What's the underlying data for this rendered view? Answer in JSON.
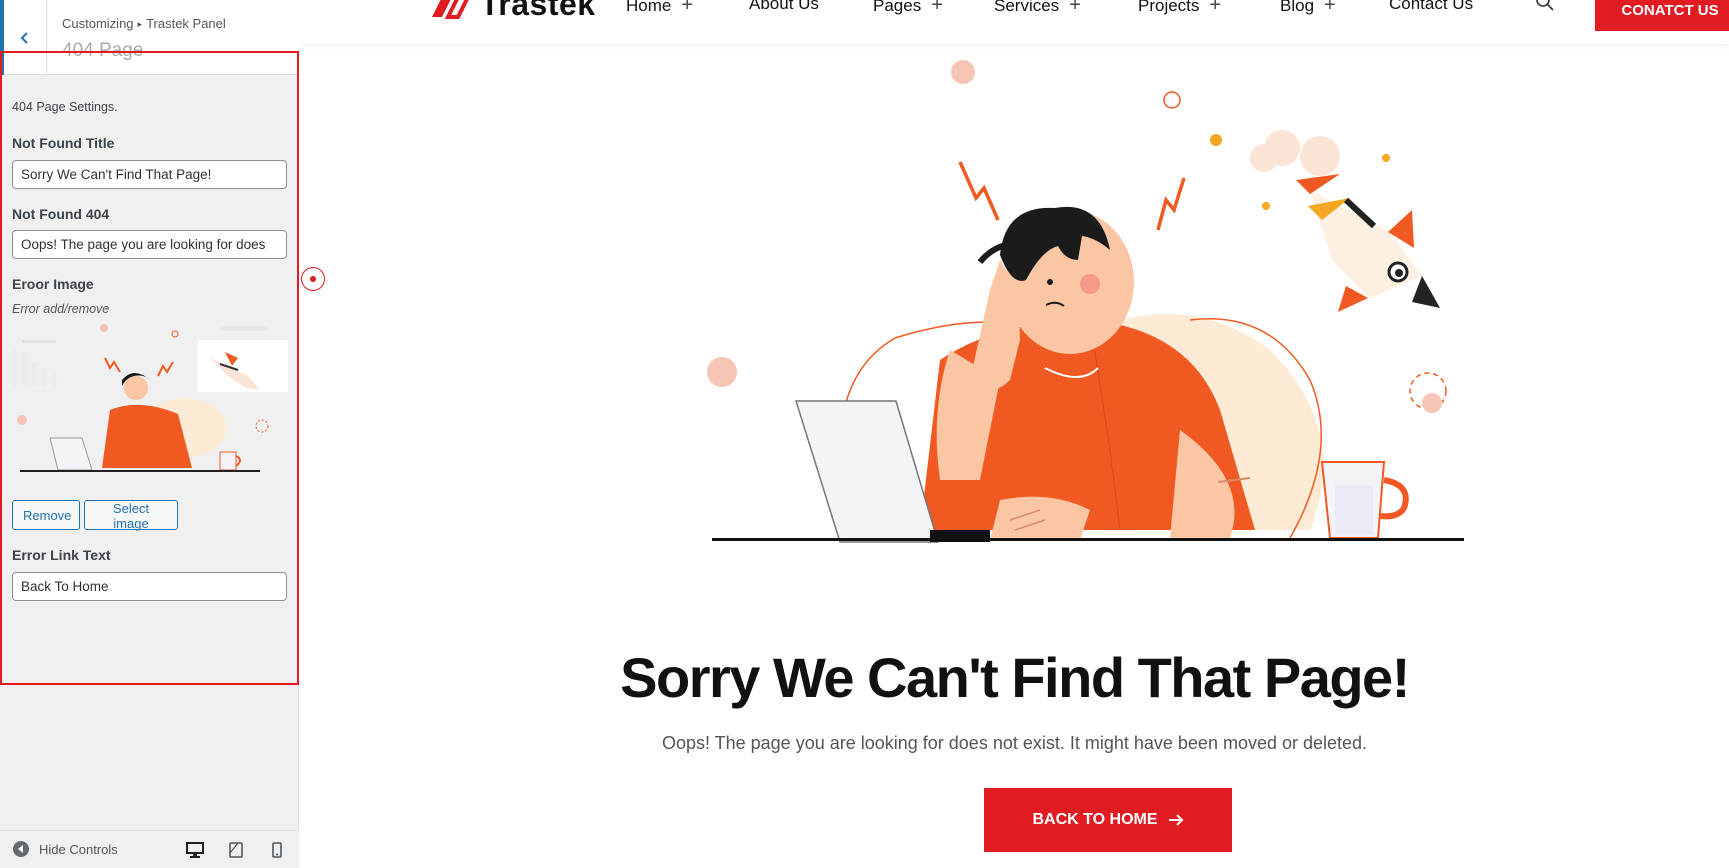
{
  "customizer": {
    "breadcrumb_root": "Customizing",
    "breadcrumb_panel": "Trastek Panel",
    "section_title": "404 Page",
    "description": "404 Page Settings.",
    "controls": {
      "title_label": "Not Found Title",
      "title_value": "Sorry We Can't Find That Page!",
      "text_label": "Not Found 404",
      "text_value": "Oops! The page you are looking for does",
      "image_label": "Eroor Image",
      "image_desc": "Error add/remove",
      "remove_label": "Remove",
      "select_label": "Select image",
      "link_label": "Error Link Text",
      "link_value": "Back To Home"
    },
    "footer": {
      "hide_label": "Hide Controls"
    }
  },
  "site": {
    "logo_text": "Trastek",
    "nav": [
      {
        "label": "Home",
        "has_submenu": true
      },
      {
        "label": "About Us",
        "has_submenu": false
      },
      {
        "label": "Pages",
        "has_submenu": true
      },
      {
        "label": "Services",
        "has_submenu": true
      },
      {
        "label": "Projects",
        "has_submenu": true
      },
      {
        "label": "Blog",
        "has_submenu": true
      },
      {
        "label": "Contact Us",
        "has_submenu": false
      }
    ],
    "cta_label": "CONATCT US",
    "error_title": "Sorry We Can't Find That Page!",
    "error_text": "Oops! The page you are looking for does not exist. It might have been moved or deleted.",
    "home_button": "BACK TO HOME"
  },
  "colors": {
    "brand_red": "#e01c22",
    "illustration_orange": "#f05a22",
    "wp_blue": "#2271b1"
  }
}
